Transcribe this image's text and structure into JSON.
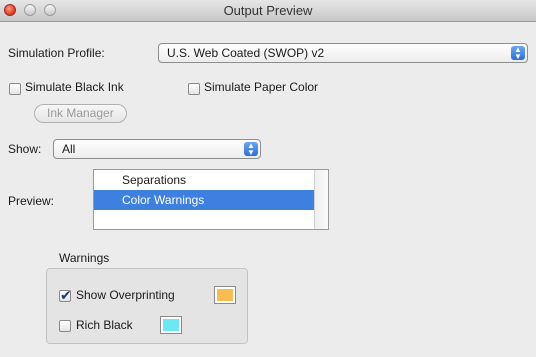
{
  "window": {
    "title": "Output Preview"
  },
  "simulation_profile": {
    "label": "Simulation Profile:",
    "value": "U.S. Web Coated (SWOP) v2"
  },
  "simulate_black_ink": {
    "label": "Simulate Black Ink",
    "checked": false
  },
  "simulate_paper_color": {
    "label": "Simulate Paper Color",
    "checked": false
  },
  "ink_manager": {
    "label": "Ink Manager"
  },
  "show": {
    "label": "Show:",
    "value": "All"
  },
  "preview": {
    "label": "Preview:",
    "items": [
      {
        "label": "Separations",
        "selected": false
      },
      {
        "label": "Color Warnings",
        "selected": true
      }
    ]
  },
  "warnings": {
    "title": "Warnings",
    "show_overprinting": {
      "label": "Show Overprinting",
      "checked": true,
      "color": "#f7bd52"
    },
    "rich_black": {
      "label": "Rich Black",
      "checked": false,
      "color": "#6ee7f5"
    }
  }
}
